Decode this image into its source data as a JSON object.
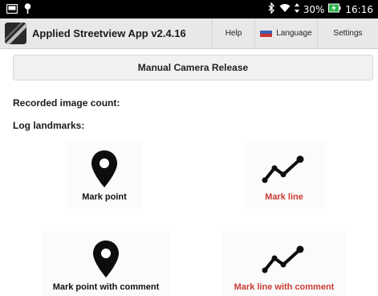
{
  "status_bar": {
    "battery": "30%",
    "time": "16:16",
    "icons": [
      "gallery-icon",
      "location-pin-icon",
      "bluetooth-icon",
      "wifi-icon",
      "data-arrows-icon",
      "battery-charging-icon"
    ]
  },
  "app_bar": {
    "title": "Applied Streetview App v2.4.16",
    "help_label": "Help",
    "language_label": "Language",
    "settings_label": "Settings"
  },
  "main": {
    "release_button_label": "Manual Camera Release",
    "recorded_count_label": "Recorded image count:",
    "log_landmarks_label": "Log landmarks:",
    "tiles": [
      {
        "label": "Mark point",
        "icon": "map-pin-icon"
      },
      {
        "label": "Mark line",
        "icon": "polyline-icon"
      },
      {
        "label": "Mark point with comment",
        "icon": "map-pin-icon"
      },
      {
        "label": "Mark line with comment",
        "icon": "polyline-icon"
      }
    ]
  },
  "colors": {
    "status_bar_bg": "#000000",
    "app_bar_bg": "#e8e8e8",
    "line_label_color": "#cc3a33"
  }
}
